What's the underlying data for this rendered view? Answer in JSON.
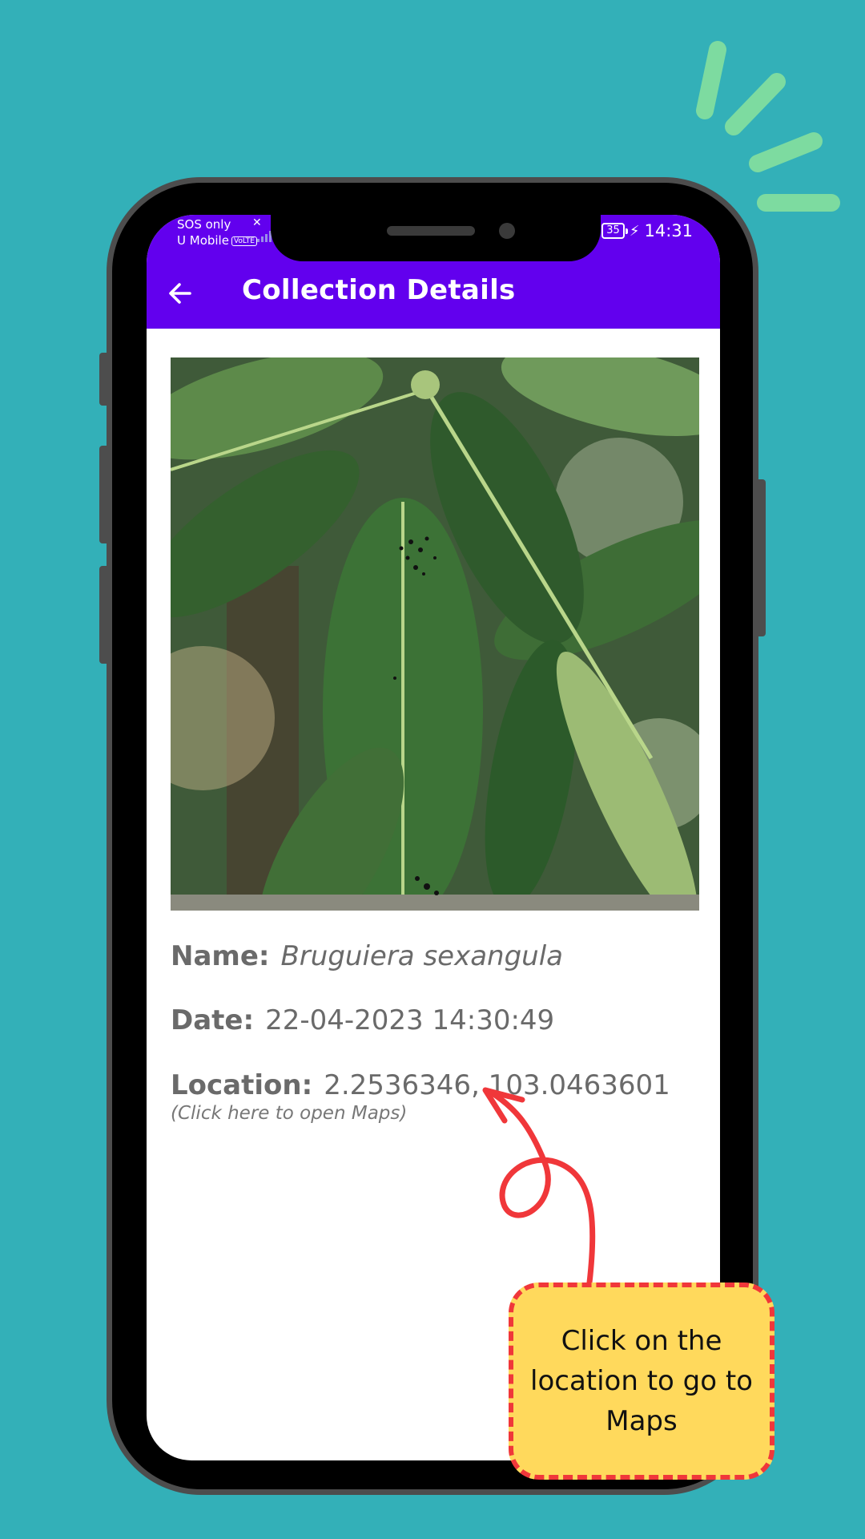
{
  "status_bar": {
    "line1": "SOS only",
    "line2": "U Mobile",
    "volte": "VoLTE",
    "battery": "35",
    "time": "14:31"
  },
  "app_bar": {
    "title": "Collection Details"
  },
  "details": {
    "name_label": "Name:",
    "name_value": "Bruguiera sexangula",
    "date_label": "Date:",
    "date_value": "22-04-2023 14:30:49",
    "location_label": "Location:",
    "location_value": "2.2536346, 103.0463601",
    "location_hint": "(Click here to open Maps)"
  },
  "annotation": {
    "callout_text": "Click on the location to go to Maps"
  },
  "colors": {
    "background": "#33b0b8",
    "app_bar": "#6200ee",
    "callout_fill": "#ffd95c",
    "callout_border": "#f0373a",
    "sparkle": "#7ddba0"
  }
}
